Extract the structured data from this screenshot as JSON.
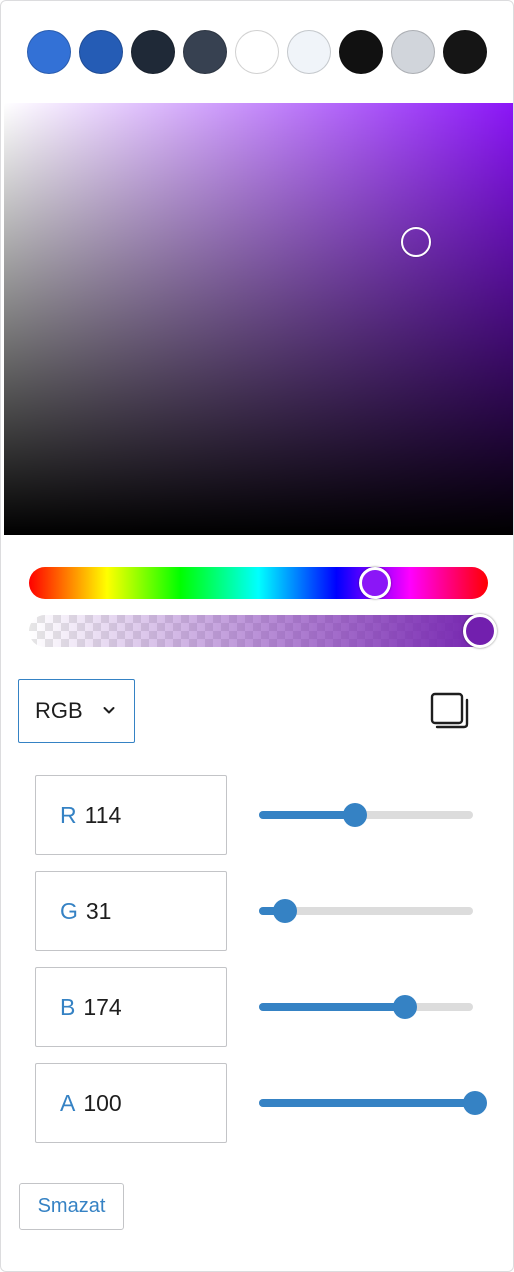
{
  "swatches": [
    {
      "color": "#3371d6",
      "name": "swatch-blue"
    },
    {
      "color": "#255cb5",
      "name": "swatch-dark-blue"
    },
    {
      "color": "#1f2937",
      "name": "swatch-navy"
    },
    {
      "color": "#374151",
      "name": "swatch-slate"
    },
    {
      "color": "#ffffff",
      "name": "swatch-white"
    },
    {
      "color": "#f0f4f9",
      "name": "swatch-light-gray"
    },
    {
      "color": "#111111",
      "name": "swatch-black"
    },
    {
      "color": "#d1d5db",
      "name": "swatch-gray"
    },
    {
      "color": "#151515",
      "name": "swatch-near-black"
    }
  ],
  "picker": {
    "hue_color": "#8b16f7",
    "current_color": "#721fae"
  },
  "mode": {
    "label": "RGB",
    "chevron_icon": "chevron-down-icon"
  },
  "copy": {
    "icon": "copy-icon"
  },
  "channels": [
    {
      "key": "r",
      "label": "R",
      "value": "114",
      "fraction": 0.447
    },
    {
      "key": "g",
      "label": "G",
      "value": "31",
      "fraction": 0.122
    },
    {
      "key": "b",
      "label": "B",
      "value": "174",
      "fraction": 0.682
    },
    {
      "key": "a",
      "label": "A",
      "value": "100",
      "fraction": 1.0
    }
  ],
  "clear_button": "Smazat",
  "accent": "#3582c4"
}
